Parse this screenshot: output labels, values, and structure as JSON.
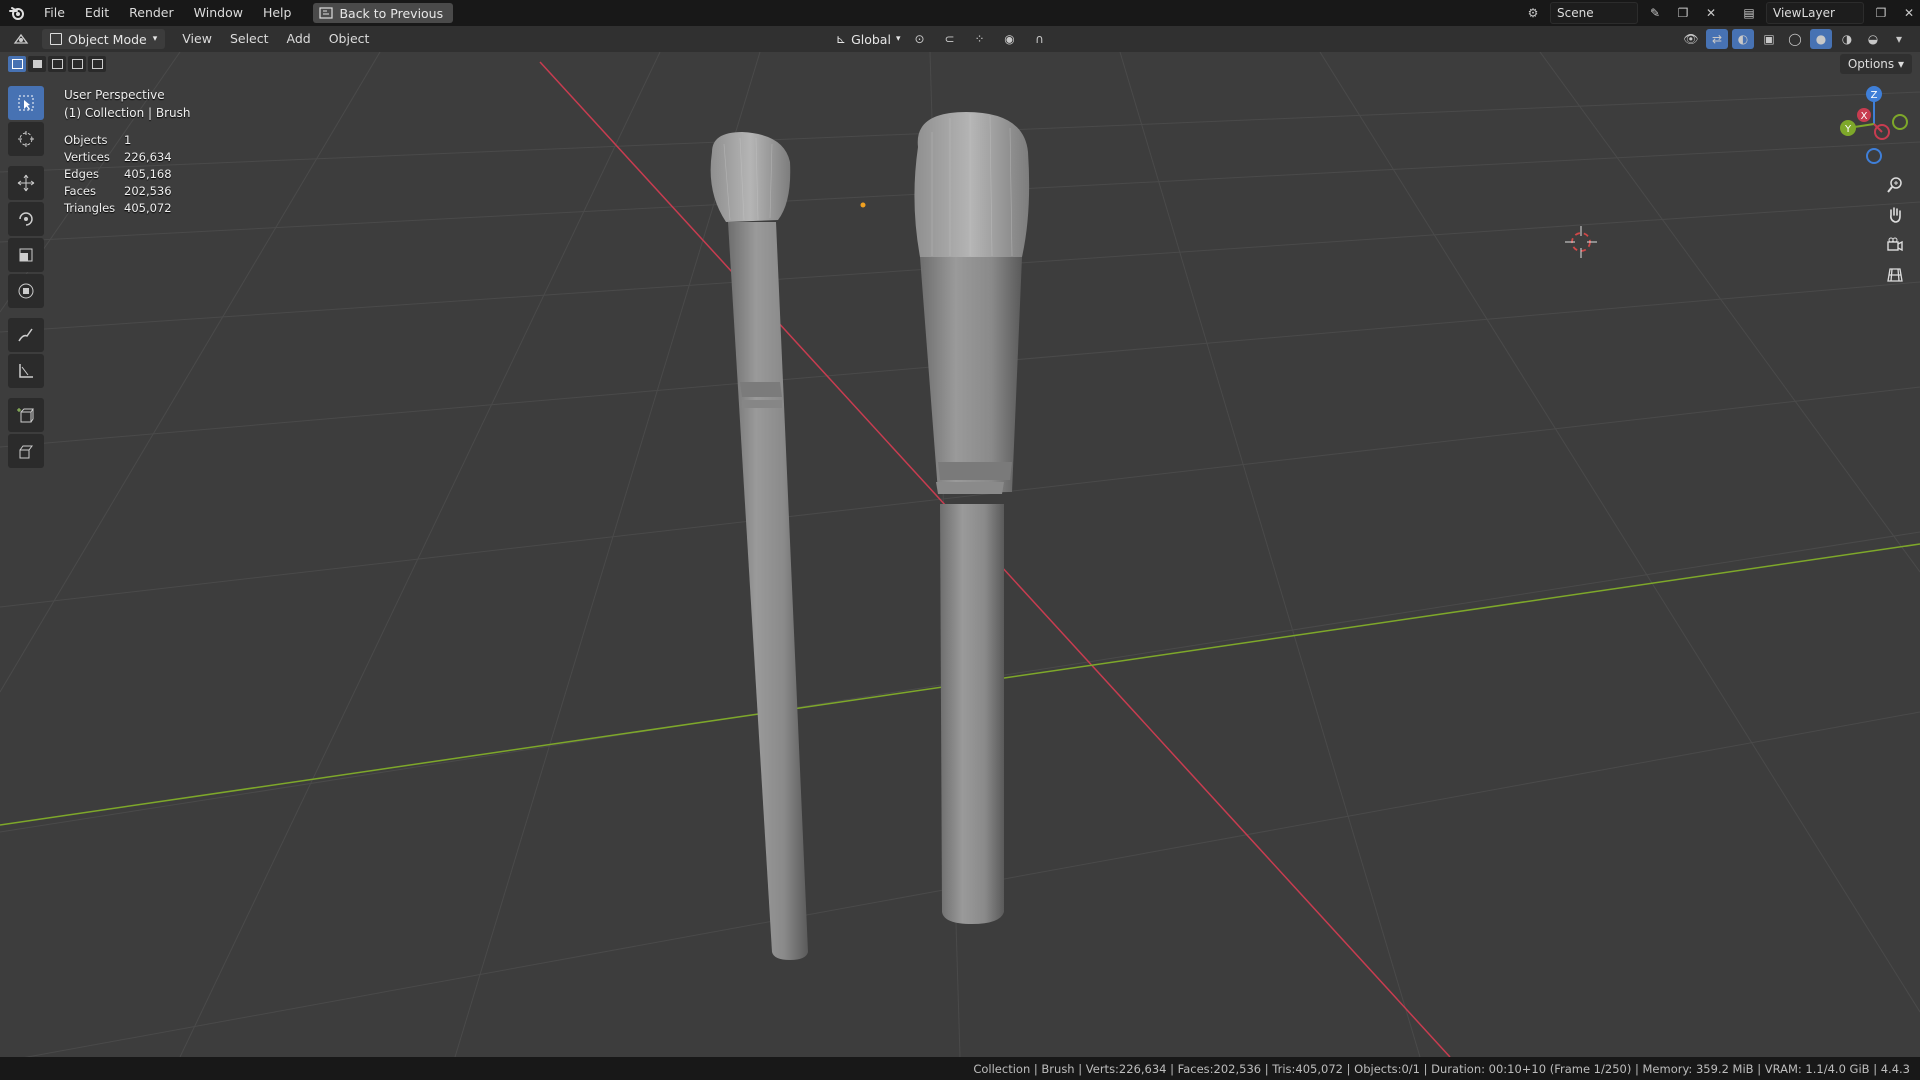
{
  "topbar": {
    "menus": [
      "File",
      "Edit",
      "Render",
      "Window",
      "Help"
    ],
    "back_label": "Back to Previous",
    "scene_name": "Scene",
    "view_layer": "ViewLayer"
  },
  "header": {
    "mode": "Object Mode",
    "menus": [
      "View",
      "Select",
      "Add",
      "Object"
    ],
    "orientation": "Global"
  },
  "viewport": {
    "options_label": "Options",
    "perspective": "User Perspective",
    "collection": "(1) Collection | Brush",
    "stats": [
      {
        "label": "Objects",
        "value": "1"
      },
      {
        "label": "Vertices",
        "value": "226,634"
      },
      {
        "label": "Edges",
        "value": "405,168"
      },
      {
        "label": "Faces",
        "value": "202,536"
      },
      {
        "label": "Triangles",
        "value": "405,072"
      }
    ],
    "gizmo_axes": {
      "x": "X",
      "y": "Y",
      "z": "Z"
    },
    "colors": {
      "background": "#3d3d3d",
      "x_axis": "#c83c50",
      "y_axis": "#7ea82a",
      "active": "#4772b3"
    }
  },
  "statusbar": {
    "text": "Collection | Brush | Verts:226,634 | Faces:202,536 | Tris:405,072 | Objects:0/1 | Duration: 00:10+10 (Frame 1/250) | Memory: 359.2 MiB | VRAM: 1.1/4.0 GiB | 4.4.3"
  }
}
